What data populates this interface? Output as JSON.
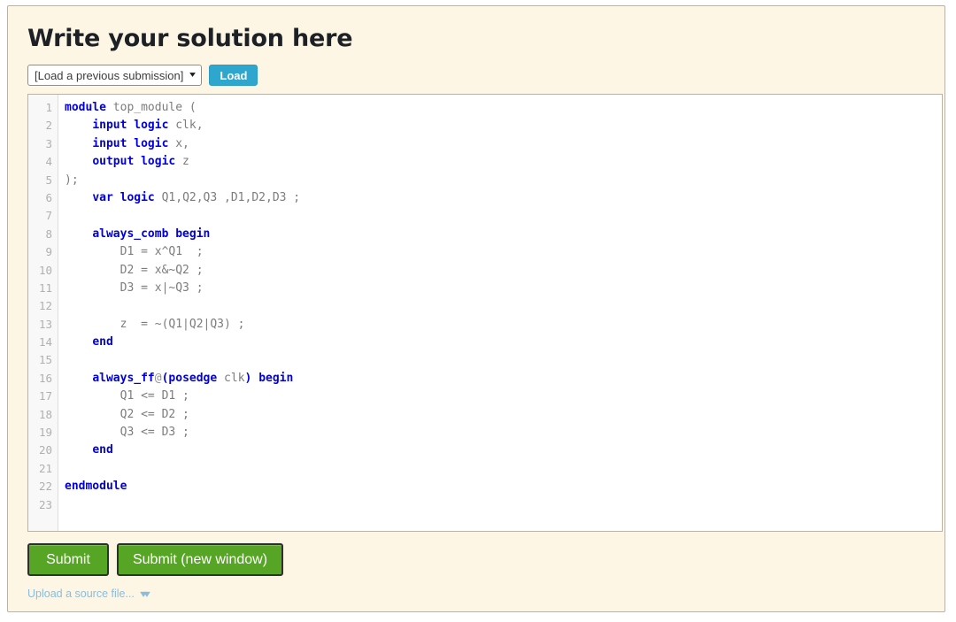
{
  "page": {
    "title": "Write your solution here",
    "panel_bg": "#fdf6e5",
    "panel_border": "#b9b2a6"
  },
  "load_row": {
    "select_value": "[Load a previous submission]",
    "select_chevron": "chevron-down-icon",
    "load_label": "Load",
    "load_color": "#2fa6cd"
  },
  "editor": {
    "line_numbers": [
      "1",
      "2",
      "3",
      "4",
      "5",
      "6",
      "7",
      "8",
      "9",
      "10",
      "11",
      "12",
      "13",
      "14",
      "15",
      "16",
      "17",
      "18",
      "19",
      "20",
      "21",
      "22",
      "23"
    ],
    "keyword_color": "#0000dd",
    "identifier_color": "#7c7c7c",
    "lines": [
      {
        "n": 1,
        "tokens": [
          {
            "t": "kw",
            "v": "module"
          },
          {
            "t": "id",
            "v": " top_module ("
          }
        ]
      },
      {
        "n": 2,
        "tokens": [
          {
            "t": "id",
            "v": "    "
          },
          {
            "t": "kw",
            "v": "input logic"
          },
          {
            "t": "id",
            "v": " clk,"
          }
        ]
      },
      {
        "n": 3,
        "tokens": [
          {
            "t": "id",
            "v": "    "
          },
          {
            "t": "kw",
            "v": "input logic"
          },
          {
            "t": "id",
            "v": " x,"
          }
        ]
      },
      {
        "n": 4,
        "tokens": [
          {
            "t": "id",
            "v": "    "
          },
          {
            "t": "kw",
            "v": "output logic"
          },
          {
            "t": "id",
            "v": " z"
          }
        ]
      },
      {
        "n": 5,
        "tokens": [
          {
            "t": "id",
            "v": ");"
          }
        ]
      },
      {
        "n": 6,
        "tokens": [
          {
            "t": "id",
            "v": "    "
          },
          {
            "t": "kw",
            "v": "var logic"
          },
          {
            "t": "id",
            "v": " Q1,Q2,Q3 ,D1,D2,D3 ;"
          }
        ]
      },
      {
        "n": 7,
        "tokens": [
          {
            "t": "id",
            "v": ""
          }
        ]
      },
      {
        "n": 8,
        "tokens": [
          {
            "t": "id",
            "v": "    "
          },
          {
            "t": "kw",
            "v": "always_comb begin"
          }
        ]
      },
      {
        "n": 9,
        "tokens": [
          {
            "t": "id",
            "v": "        D1 = x^Q1  ;"
          }
        ]
      },
      {
        "n": 10,
        "tokens": [
          {
            "t": "id",
            "v": "        D2 = x&~Q2 ;"
          }
        ]
      },
      {
        "n": 11,
        "tokens": [
          {
            "t": "id",
            "v": "        D3 = x|~Q3 ;"
          }
        ]
      },
      {
        "n": 12,
        "tokens": [
          {
            "t": "id",
            "v": ""
          }
        ]
      },
      {
        "n": 13,
        "tokens": [
          {
            "t": "id",
            "v": "        z  = ~(Q1|Q2|Q3) ;"
          }
        ]
      },
      {
        "n": 14,
        "tokens": [
          {
            "t": "id",
            "v": "    "
          },
          {
            "t": "kw",
            "v": "end"
          }
        ]
      },
      {
        "n": 15,
        "tokens": [
          {
            "t": "id",
            "v": ""
          }
        ]
      },
      {
        "n": 16,
        "tokens": [
          {
            "t": "id",
            "v": "    "
          },
          {
            "t": "kw",
            "v": "always_ff"
          },
          {
            "t": "op",
            "v": "@"
          },
          {
            "t": "kw",
            "v": "("
          },
          {
            "t": "kw",
            "v": "posedge"
          },
          {
            "t": "id",
            "v": " clk"
          },
          {
            "t": "kw",
            "v": ")"
          },
          {
            "t": "id",
            "v": " "
          },
          {
            "t": "kw",
            "v": "begin"
          }
        ]
      },
      {
        "n": 17,
        "tokens": [
          {
            "t": "id",
            "v": "        Q1 <= D1 ;"
          }
        ]
      },
      {
        "n": 18,
        "tokens": [
          {
            "t": "id",
            "v": "        Q2 <= D2 ;"
          }
        ]
      },
      {
        "n": 19,
        "tokens": [
          {
            "t": "id",
            "v": "        Q3 <= D3 ;"
          }
        ]
      },
      {
        "n": 20,
        "tokens": [
          {
            "t": "id",
            "v": "    "
          },
          {
            "t": "kw",
            "v": "end"
          }
        ]
      },
      {
        "n": 21,
        "tokens": [
          {
            "t": "id",
            "v": ""
          }
        ]
      },
      {
        "n": 22,
        "tokens": [
          {
            "t": "kw",
            "v": "endmodule"
          }
        ]
      },
      {
        "n": 23,
        "tokens": [
          {
            "t": "id",
            "v": ""
          }
        ]
      }
    ]
  },
  "actions": {
    "submit_label": "Submit",
    "submit_new_window_label": "Submit (new window)",
    "button_color": "#56a524",
    "upload_label": "Upload a source file...",
    "upload_chevron": "double-chevron-down-icon",
    "upload_link_color": "#8cbcdc"
  }
}
